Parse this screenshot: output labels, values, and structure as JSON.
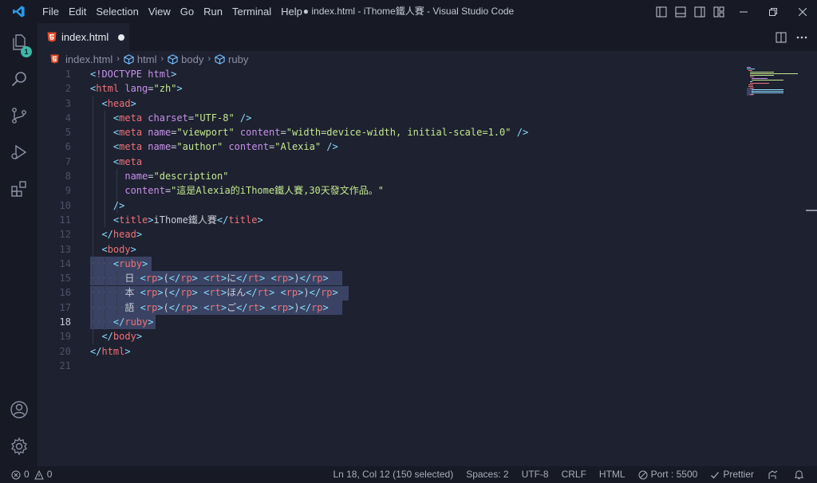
{
  "menu": [
    "File",
    "Edit",
    "Selection",
    "View",
    "Go",
    "Run",
    "Terminal",
    "Help"
  ],
  "window_title": "● index.html - iThome鐵人賽 - Visual Studio Code",
  "activity": {
    "explorer_badge": "1"
  },
  "tab": {
    "label": "index.html",
    "dirty": true
  },
  "breadcrumb": [
    "index.html",
    "html",
    "body",
    "ruby"
  ],
  "editor": {
    "active_line": 18,
    "line_numbers": [
      "1",
      "2",
      "3",
      "4",
      "5",
      "6",
      "7",
      "8",
      "9",
      "10",
      "11",
      "12",
      "13",
      "14",
      "15",
      "16",
      "17",
      "18",
      "19",
      "20",
      "21"
    ]
  },
  "colors": {
    "tag": "#f07178",
    "bracket": "#89ddff",
    "attr": "#c792ea",
    "string": "#c3e88d",
    "text": "#c8ccd6",
    "doctype": "#c792ea",
    "selection": "#3a4363"
  },
  "statusbar": {
    "errors": "0",
    "warnings": "0",
    "position": "Ln 18, Col 12 (150 selected)",
    "spaces": "Spaces: 2",
    "encoding": "UTF-8",
    "eol": "CRLF",
    "language": "HTML",
    "port": "Port : 5500",
    "prettier": "Prettier"
  }
}
